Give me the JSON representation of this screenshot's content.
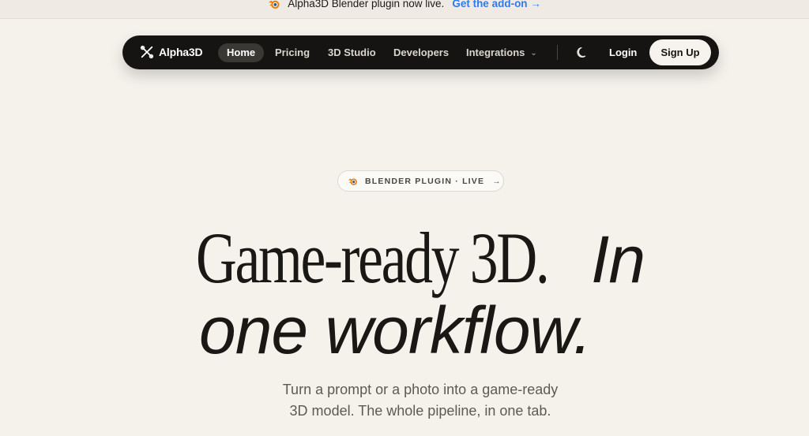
{
  "announcement": {
    "text": "Alpha3D Blender plugin now live.",
    "link": "Get the add-on →",
    "icon": "blender-icon",
    "link_color": "#2f7be6"
  },
  "nav": {
    "brand": "Alpha3D",
    "items": [
      {
        "label": "Home",
        "active": true
      },
      {
        "label": "Pricing"
      },
      {
        "label": "3D Studio"
      },
      {
        "label": "Developers"
      },
      {
        "label": "Integrations",
        "has_dropdown": true
      }
    ],
    "theme_icon": "moon-icon",
    "login": "Login",
    "signup": "Sign Up"
  },
  "hero": {
    "badge": "BLENDER PLUGIN · LIVE",
    "badge_arrow": "→",
    "headline_serif": "Game-ready 3D.",
    "headline_italic_1": "In",
    "headline_italic_2": "one workflow.",
    "subtitle_line1": "Turn a prompt or a photo into a game-ready",
    "subtitle_line2": "3D model. The whole pipeline, in one tab."
  },
  "colors": {
    "page_bg": "#f5f2ec",
    "nav_bg": "#151412",
    "blender_orange": "#e87d0d"
  }
}
